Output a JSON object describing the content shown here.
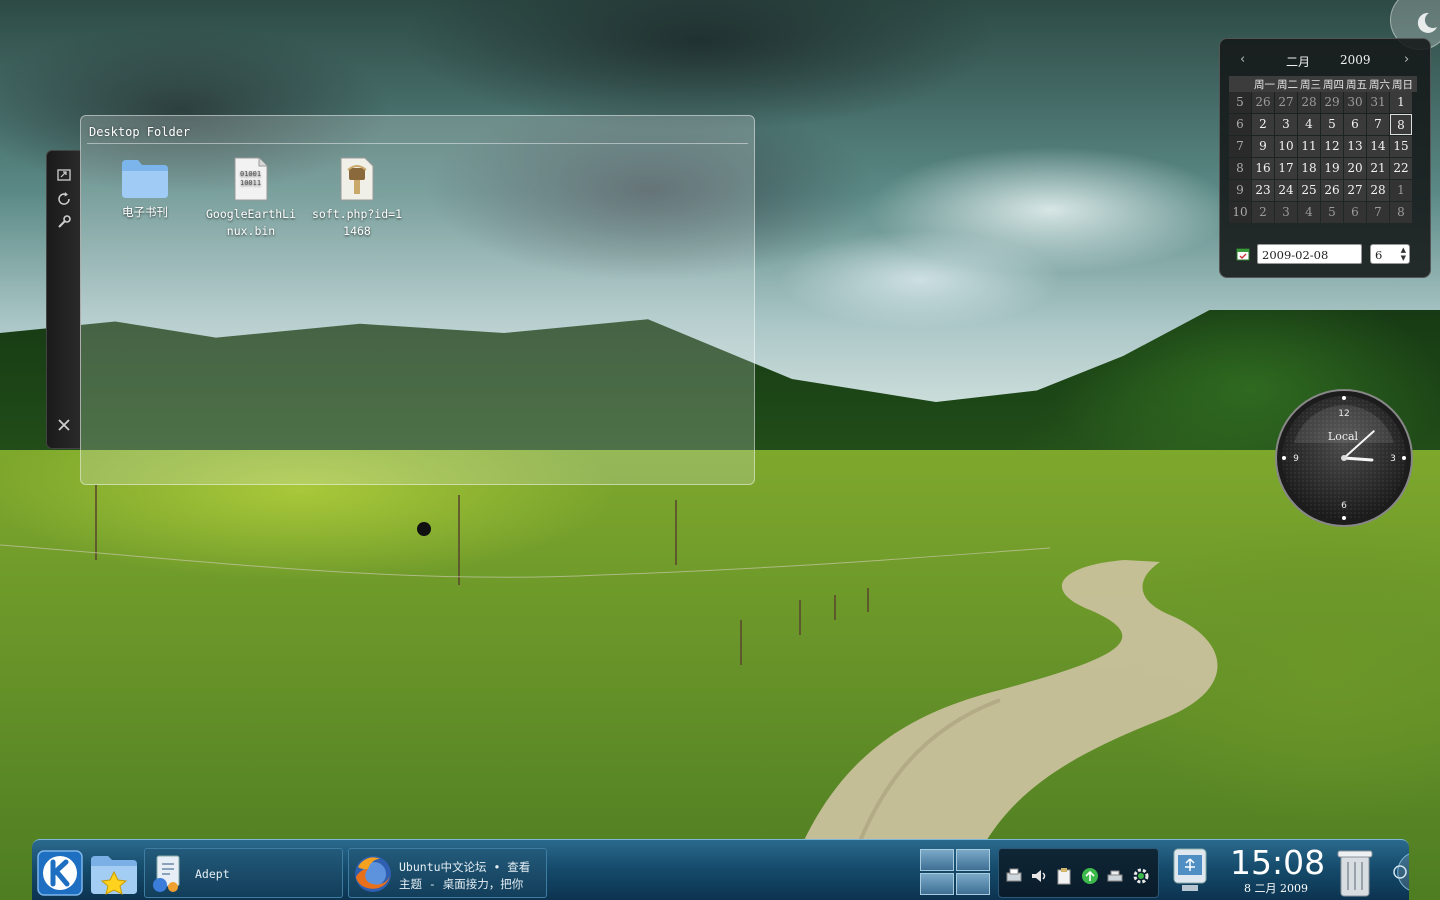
{
  "folder_view": {
    "title": "Desktop Folder",
    "files": [
      {
        "name": "电子书刊",
        "icon": "folder-icon"
      },
      {
        "name": "GoogleEarthLinux.bin",
        "icon": "binary-file-icon"
      },
      {
        "name": "soft.php?id=11468",
        "icon": "archive-file-icon"
      }
    ]
  },
  "handle": {
    "icons": [
      "resize-icon",
      "rotate-icon",
      "settings-icon",
      "close-icon"
    ]
  },
  "calendar": {
    "month": "二月",
    "year": "2009",
    "weekday_headers": [
      "周一",
      "周二",
      "周三",
      "周四",
      "周五",
      "周六",
      "周日"
    ],
    "week_numbers": [
      "5",
      "6",
      "7",
      "8",
      "9",
      "10"
    ],
    "rows": [
      [
        "26",
        "27",
        "28",
        "29",
        "30",
        "31",
        "1"
      ],
      [
        "2",
        "3",
        "4",
        "5",
        "6",
        "7",
        "8"
      ],
      [
        "9",
        "10",
        "11",
        "12",
        "13",
        "14",
        "15"
      ],
      [
        "16",
        "17",
        "18",
        "19",
        "20",
        "21",
        "22"
      ],
      [
        "23",
        "24",
        "25",
        "26",
        "27",
        "28",
        "1"
      ],
      [
        "2",
        "3",
        "4",
        "5",
        "6",
        "7",
        "8"
      ]
    ],
    "selected_day": "8",
    "date_value": "2009-02-08",
    "week_value": "6"
  },
  "analog_clock": {
    "label": "Local",
    "numerals": [
      "12",
      "3",
      "6",
      "9"
    ],
    "time": "15:08"
  },
  "panel": {
    "kickoff_icon": "kde-menu-icon",
    "places_icon": "folder-favorites-icon",
    "tasks": [
      {
        "label": "Adept",
        "icon": "adept-icon"
      },
      {
        "label_line1": "Ubuntu中文论坛 • 查看",
        "label_line2": "主题 - 桌面接力，把你",
        "icon": "firefox-icon"
      }
    ],
    "tray_icons": [
      "printer-icon",
      "volume-icon",
      "clipboard-icon",
      "network-icon",
      "device-icon",
      "settings-gear-icon"
    ],
    "device_notifier_icon": "usb-device-icon",
    "clock_time": "15:08",
    "clock_date": "8 二月 2009",
    "trash_icon": "trash-icon"
  },
  "colors": {
    "panel_top": "#2b6a8d",
    "panel_bottom": "#0c3350",
    "calendar_bg": "#141818"
  }
}
